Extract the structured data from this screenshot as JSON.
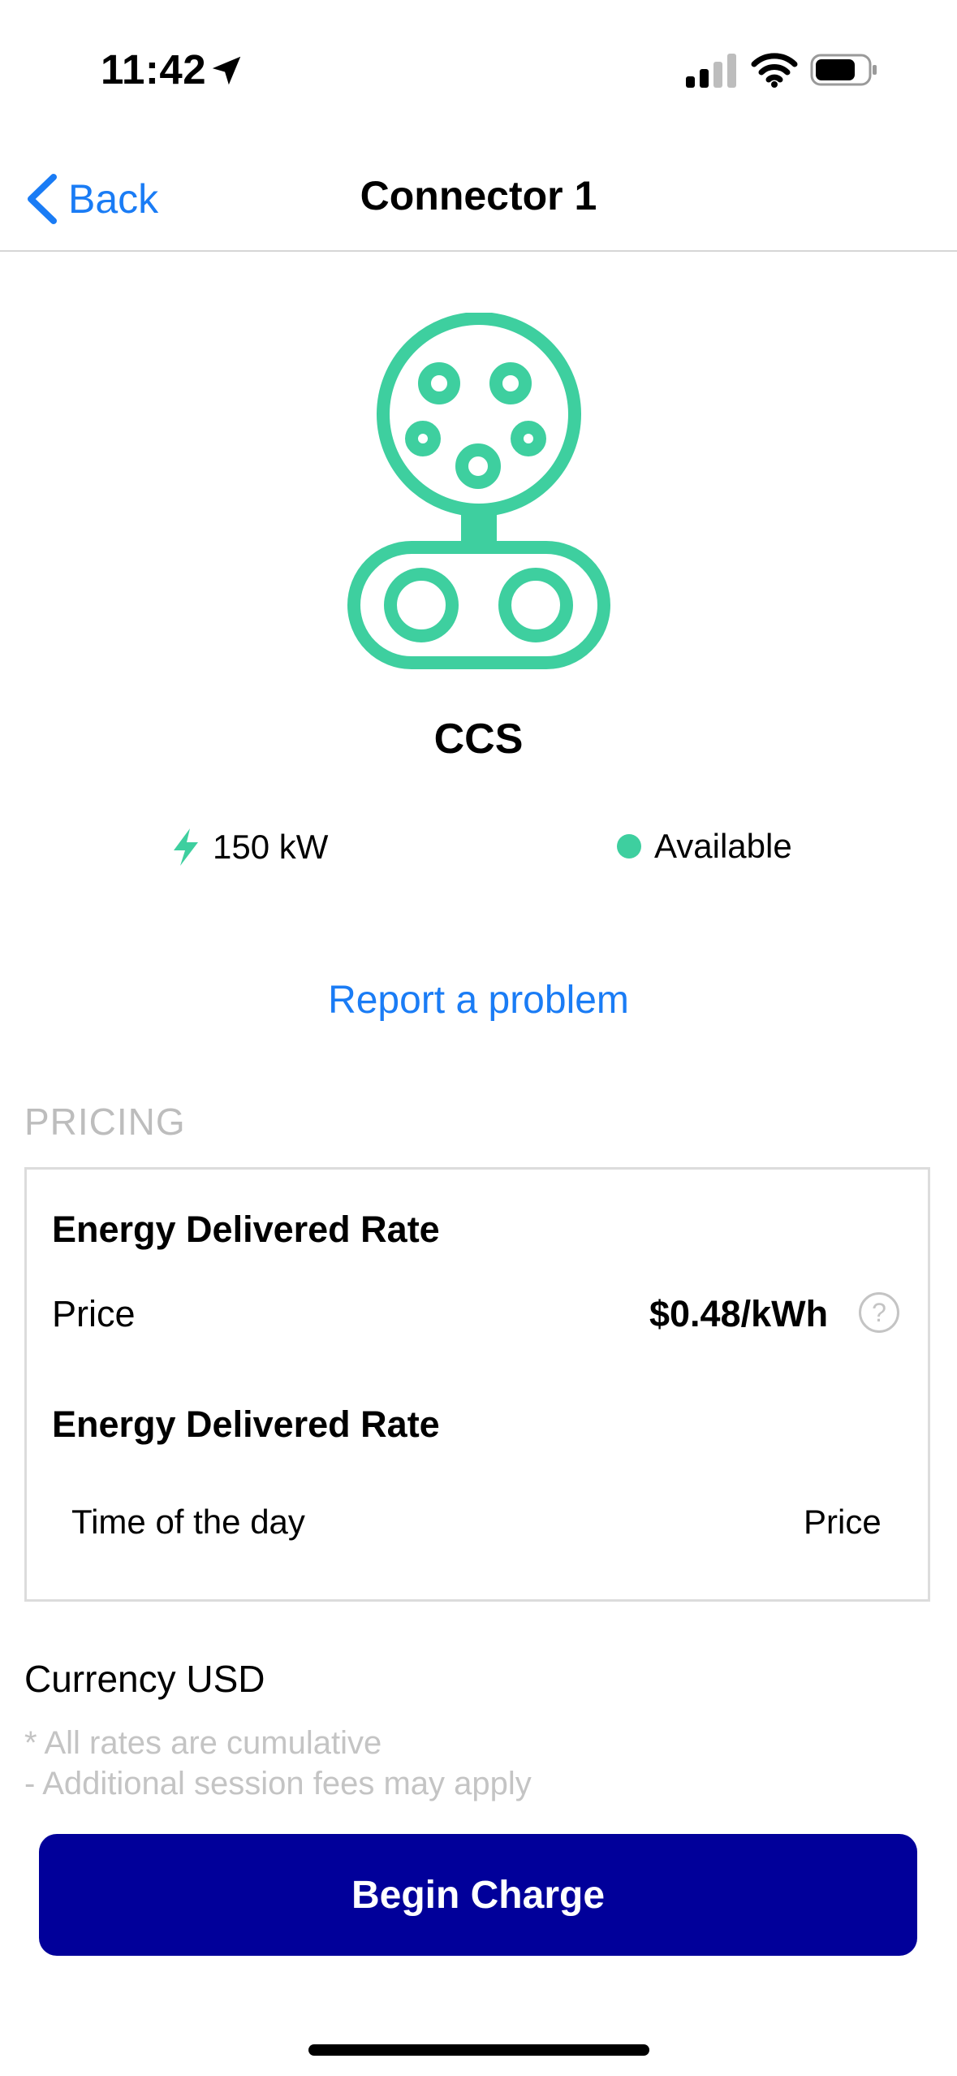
{
  "status_bar": {
    "time": "11:42"
  },
  "nav": {
    "back_label": "Back",
    "title": "Connector 1"
  },
  "connector": {
    "type": "CCS",
    "power": "150 kW",
    "availability": "Available",
    "accent_color": "#3ecf9f"
  },
  "report_link": "Report a problem",
  "pricing": {
    "header": "PRICING",
    "rates": [
      {
        "title": "Energy Delivered Rate",
        "price_label": "Price",
        "price_value": "$0.48/kWh"
      },
      {
        "title": "Energy Delivered Rate",
        "column_time": "Time of the day",
        "column_price": "Price"
      }
    ]
  },
  "currency": "Currency USD",
  "notes": [
    "* All rates are cumulative",
    "- Additional session fees may apply"
  ],
  "begin_button": "Begin Charge",
  "colors": {
    "link": "#1a7cf5",
    "primary_button": "#01009a",
    "available": "#3ecf9f"
  }
}
